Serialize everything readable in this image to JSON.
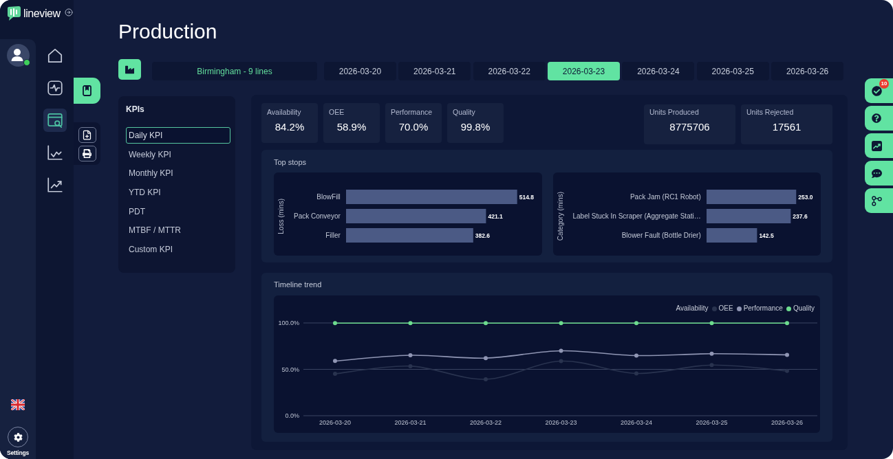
{
  "brand": {
    "name": "lineview"
  },
  "user": {
    "online": true
  },
  "nav": [
    {
      "selected": false
    },
    {
      "selected": false
    },
    {
      "selected": true
    },
    {
      "selected": false
    },
    {
      "selected": false
    }
  ],
  "settings": {
    "label": "Settings"
  },
  "page": {
    "title": "Production"
  },
  "site_selector": {
    "value": "Birmingham - 9 lines"
  },
  "date_tabs": [
    {
      "label": "2026-03-20",
      "selected": false
    },
    {
      "label": "2026-03-21",
      "selected": false
    },
    {
      "label": "2026-03-22",
      "selected": false
    },
    {
      "label": "2026-03-23",
      "selected": true
    },
    {
      "label": "2026-03-24",
      "selected": false
    },
    {
      "label": "2026-03-25",
      "selected": false
    },
    {
      "label": "2026-03-26",
      "selected": false
    }
  ],
  "kpi_menu": {
    "title": "KPIs",
    "items": [
      {
        "label": "Daily KPI",
        "selected": true
      },
      {
        "label": "Weekly KPI",
        "selected": false
      },
      {
        "label": "Monthly KPI",
        "selected": false
      },
      {
        "label": "YTD KPI",
        "selected": false
      },
      {
        "label": "PDT",
        "selected": false
      },
      {
        "label": "MTBF / MTTR",
        "selected": false
      },
      {
        "label": "Custom KPI",
        "selected": false
      }
    ]
  },
  "kpi_cards": [
    {
      "label": "Availability",
      "value": "84.2%"
    },
    {
      "label": "OEE",
      "value": "58.9%"
    },
    {
      "label": "Performance",
      "value": "70.0%"
    },
    {
      "label": "Quality",
      "value": "99.8%"
    }
  ],
  "unit_cards": [
    {
      "label": "Units Produced",
      "value": "8775706"
    },
    {
      "label": "Units Rejected",
      "value": "17561"
    }
  ],
  "top_stops": {
    "title": "Top stops",
    "chart_data": [
      {
        "type": "bar",
        "orientation": "horizontal",
        "ylabel": "Loss (mins)",
        "categories": [
          "BlowFill",
          "Pack Conveyor",
          "Filler"
        ],
        "values": [
          514.8,
          421.1,
          382.6
        ],
        "color": "#4b5a85",
        "value_labels": [
          "514.8",
          "421.1",
          "382.6"
        ]
      },
      {
        "type": "bar",
        "orientation": "horizontal",
        "ylabel": "Category (mins)",
        "categories": [
          "Pack Jam (RC1 Robot)",
          "Label Stuck In Scraper (Aggregate Stati…",
          "Blower Fault (Bottle Drier)"
        ],
        "values": [
          253.0,
          237.6,
          142.5
        ],
        "color": "#4b5a85",
        "value_labels": [
          "253.0",
          "237.6",
          "142.5"
        ]
      }
    ]
  },
  "timeline": {
    "title": "Timeline trend",
    "chart_data": {
      "type": "line",
      "categories": [
        "2026-03-20",
        "2026-03-21",
        "2026-03-22",
        "2026-03-23",
        "2026-03-24",
        "2026-03-25",
        "2026-03-26"
      ],
      "ylim": [
        0,
        100
      ],
      "yticks": [
        {
          "value": 0,
          "label": "0.0%"
        },
        {
          "value": 50,
          "label": "50.0%"
        },
        {
          "value": 100,
          "label": "100.0%"
        }
      ],
      "grid": true,
      "legend": "top-right",
      "marker": "circle",
      "series": [
        {
          "name": "Availability",
          "values": [
            null,
            null,
            null,
            null,
            null,
            null,
            null
          ]
        },
        {
          "name": "OEE",
          "color": "#29334f",
          "values": [
            45.2,
            53.4,
            39.3,
            58.9,
            45.6,
            54.6,
            48.3
          ]
        },
        {
          "name": "Performance",
          "color": "#9096b4",
          "values": [
            59.0,
            65.2,
            62.1,
            70.0,
            64.8,
            66.8,
            65.6
          ]
        },
        {
          "name": "Quality",
          "color": "#6ddc8e",
          "values": [
            99.8,
            99.8,
            99.8,
            99.8,
            99.8,
            99.8,
            99.8
          ]
        }
      ]
    }
  },
  "right_toolbar": {
    "badge": "10"
  }
}
